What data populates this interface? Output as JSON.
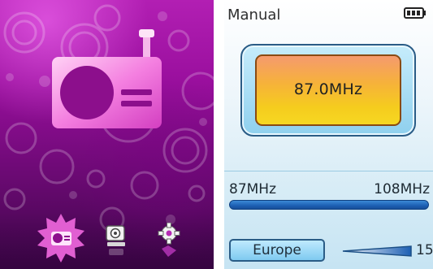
{
  "left_panel": {
    "menu": [
      {
        "name": "radio",
        "selected": true
      },
      {
        "name": "camera",
        "selected": false
      },
      {
        "name": "settings",
        "selected": false
      }
    ],
    "theme_color": "#a11aa6"
  },
  "right_panel": {
    "mode_label": "Manual",
    "battery_icon": "battery-full-icon",
    "frequency": "87.0MHz",
    "range_min_label": "87MHz",
    "range_max_label": "108MHz",
    "tuning_position_fraction": 0.0,
    "region": "Europe",
    "volume": "15",
    "volume_fraction": 0.5,
    "accent_color": "#1d5fb3",
    "display_color": "#f5c32a"
  }
}
